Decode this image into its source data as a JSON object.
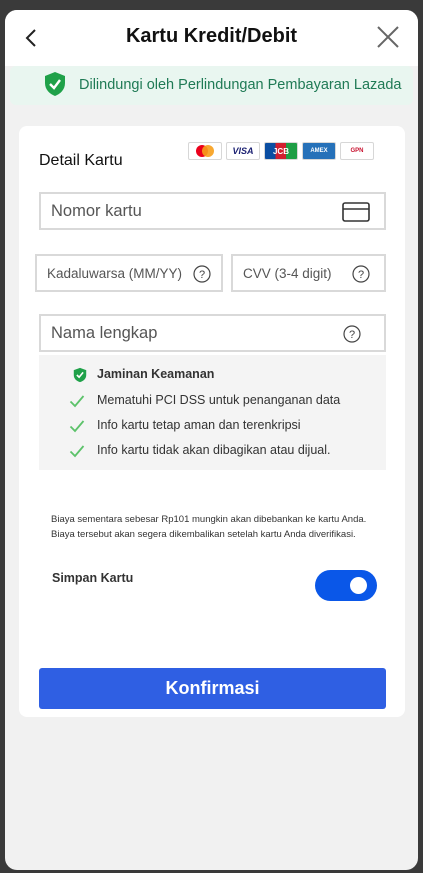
{
  "header": {
    "title": "Kartu Kredit/Debit",
    "back_icon": "chevron-left-icon",
    "close_icon": "close-icon"
  },
  "protection": {
    "icon": "shield-check-icon",
    "text": "Dilindungi oleh Perlindungan Pembayaran Lazada",
    "color": "#1f7a55"
  },
  "card_form": {
    "title": "Detail Kartu",
    "brands": [
      {
        "name": "mastercard-logo"
      },
      {
        "name": "visa-logo",
        "text": "VISA"
      },
      {
        "name": "jcb-logo",
        "text": "JCB"
      },
      {
        "name": "amex-logo",
        "text": "AMEX"
      },
      {
        "name": "gpn-logo",
        "text": "GPN"
      }
    ],
    "card_number": {
      "placeholder": "Nomor kartu",
      "value": "",
      "icon": "credit-card-icon"
    },
    "expiry": {
      "placeholder": "Kadaluwarsa (MM/YY)",
      "value": "",
      "icon": "help-circle-icon"
    },
    "cvv": {
      "placeholder": "CVV (3-4 digit)",
      "value": "",
      "icon": "help-circle-icon"
    },
    "full_name": {
      "placeholder": "Nama lengkap",
      "value": "",
      "icon": "help-circle-icon"
    }
  },
  "security": {
    "title": "Jaminan Keamanan",
    "title_icon": "shield-check-icon",
    "items": [
      "Mematuhi PCI DSS untuk penanganan data",
      "Info kartu tetap aman dan terenkripsi",
      "Info kartu tidak akan dibagikan atau dijual."
    ],
    "item_icon": "check-icon"
  },
  "note": "Biaya sementara sebesar Rp101 mungkin akan dibebankan ke kartu Anda. Biaya tersebut akan segera dikembalikan setelah kartu Anda diverifikasi.",
  "save_card": {
    "label": "Simpan Kartu",
    "enabled": true
  },
  "confirm_button": {
    "label": "Konfirmasi"
  },
  "colors": {
    "accent": "#2f5fe3",
    "toggle_on": "#0a57e8",
    "check_green": "#5cc26a",
    "shield_green": "#1fa149"
  }
}
